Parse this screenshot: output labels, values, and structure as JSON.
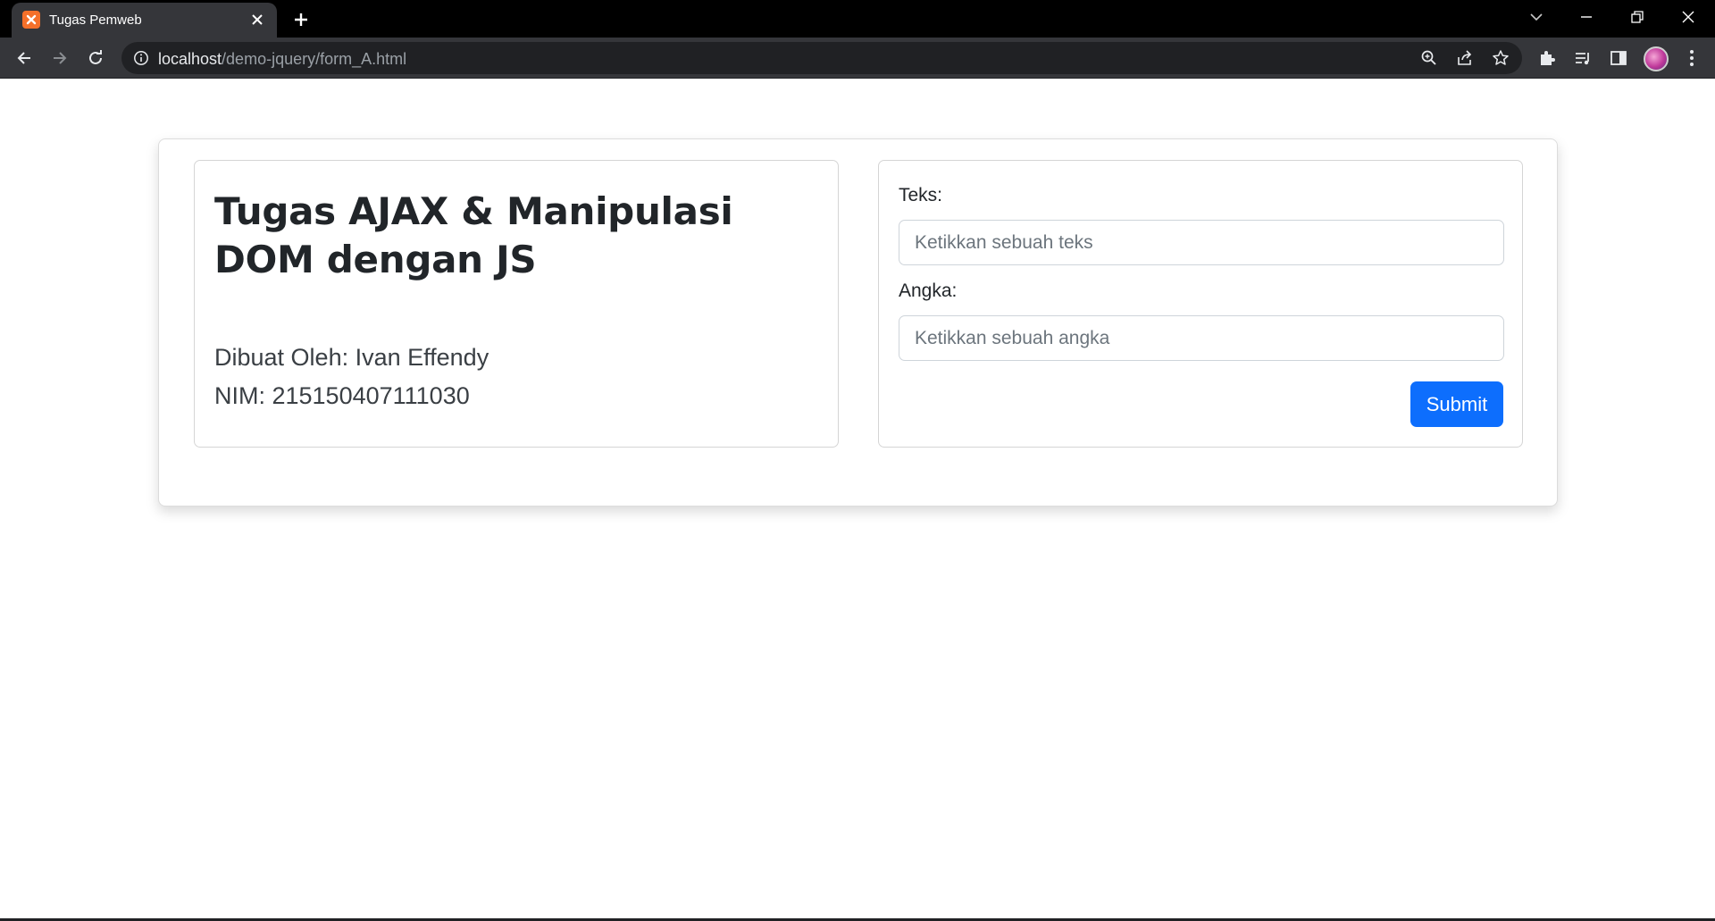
{
  "browser": {
    "tab_title": "Tugas Pemweb",
    "url_host": "localhost",
    "url_path": "/demo-jquery/form_A.html"
  },
  "page": {
    "title": "Tugas AJAX & Manipulasi DOM dengan JS",
    "author_line": "Dibuat Oleh: Ivan Effendy",
    "nim_line": "NIM: 215150407111030"
  },
  "form": {
    "teks_label": "Teks:",
    "teks_placeholder": "Ketikkan sebuah teks",
    "teks_value": "",
    "angka_label": "Angka:",
    "angka_placeholder": "Ketikkan sebuah angka",
    "angka_value": "",
    "submit_label": "Submit"
  },
  "colors": {
    "primary": "#0d6efd",
    "favicon": "#f4702a",
    "chrome_dark": "#35363a"
  }
}
